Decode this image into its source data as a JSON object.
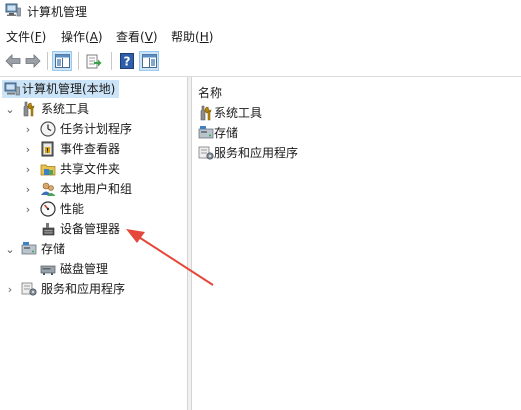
{
  "window": {
    "title": "计算机管理"
  },
  "menu": [
    {
      "label": "文件",
      "accel": "F"
    },
    {
      "label": "操作",
      "accel": "A"
    },
    {
      "label": "查看",
      "accel": "V"
    },
    {
      "label": "帮助",
      "accel": "H"
    }
  ],
  "toolbar": {
    "buttons": [
      "back-arrow-icon",
      "forward-arrow-icon",
      "console-tree-icon",
      "export-list-icon",
      "help-icon",
      "action-pane-icon"
    ]
  },
  "tree": {
    "root": "计算机管理(本地)",
    "system_tools": "系统工具",
    "task_scheduler": "任务计划程序",
    "event_viewer": "事件查看器",
    "shared_folders": "共享文件夹",
    "local_users": "本地用户和组",
    "performance": "性能",
    "device_manager": "设备管理器",
    "storage": "存储",
    "disk_management": "磁盘管理",
    "services_apps": "服务和应用程序"
  },
  "list": {
    "header": "名称",
    "items": [
      "系统工具",
      "存储",
      "服务和应用程序"
    ]
  },
  "colors": {
    "selection": "#cce4f7",
    "arrow": "#e5483a"
  }
}
